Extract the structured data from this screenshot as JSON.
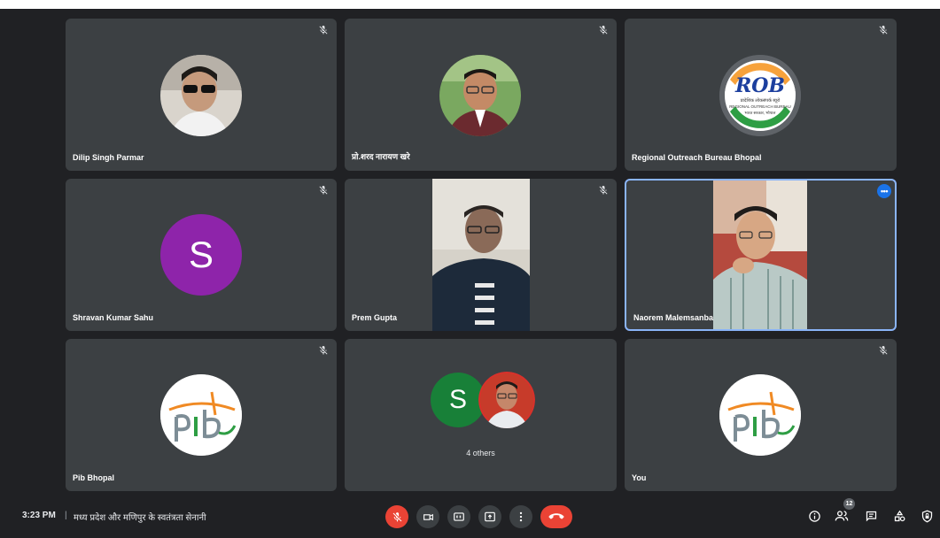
{
  "participants": [
    {
      "name": "Dilip Singh Parmar",
      "muted": true
    },
    {
      "name": "प्रो.शरद नारायण खरे",
      "muted": true
    },
    {
      "name": "Regional Outreach Bureau Bhopal",
      "muted": true
    },
    {
      "name": "Shravan Kumar Sahu",
      "muted": true,
      "initial": "S",
      "avatar_color": "#8e24aa"
    },
    {
      "name": "Prem Gupta",
      "muted": true
    },
    {
      "name": "Naorem Malemsanba",
      "muted": false
    },
    {
      "name": "Pib Bhopal",
      "muted": true
    },
    {
      "group_label": "4 others",
      "initial": "S",
      "avatar_color": "#188038"
    },
    {
      "name": "You",
      "muted": true
    }
  ],
  "rob_logo": {
    "letters": "ROB",
    "line1": "प्रादेशिक लोकसंपर्क ब्यूरो",
    "line2": "REGIONAL OUTREACH BUREAU",
    "line3": "भारत सरकार, भोपाल"
  },
  "bottom_bar": {
    "time": "3:23 PM",
    "separator": "|",
    "meeting_title": "मध्य प्रदेश और मणिपुर के स्वतंत्रता सेनानी",
    "participant_count": "12"
  },
  "colors": {
    "background": "#202124",
    "tile": "#3c4043",
    "active_border": "#8ab4f8",
    "danger": "#ea4335",
    "accent": "#1a73e8"
  }
}
